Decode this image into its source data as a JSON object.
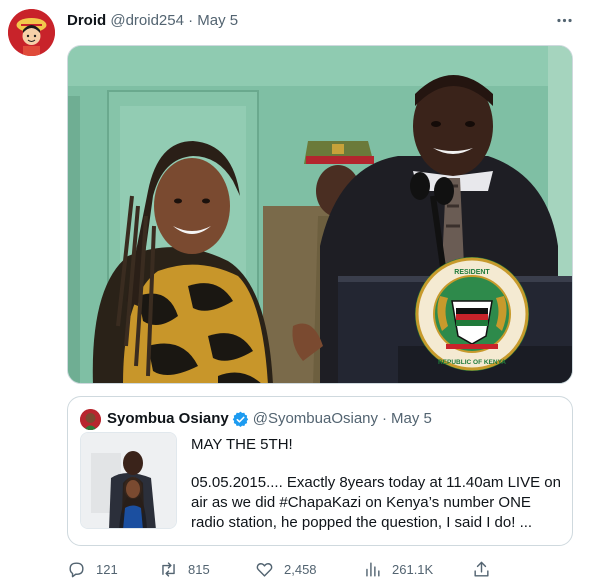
{
  "tweet": {
    "author_name": "Droid",
    "author_handle": "@droid254",
    "date": "May 5",
    "separator": "·"
  },
  "quoted": {
    "author_name": "Syombua Osiany",
    "author_handle": "@SyombuaOsiany",
    "date": "May 5",
    "line1": "MAY THE 5TH!",
    "line2": "05.05.2015.... Exactly 8years today at 11.40am LIVE on air as we did #ChapaKazi on Kenya’s number ONE radio station, he popped the question, I said I do! ..."
  },
  "seal": {
    "text": "RESIDENT REPUBLIC OF KENYA"
  },
  "actions": {
    "replies": "121",
    "retweets": "815",
    "likes": "2,458",
    "views": "261.1K"
  },
  "colors": {
    "text_primary": "#0f1419",
    "text_secondary": "#536471",
    "border": "#cfd9de",
    "verified_blue": "#1d9bf0"
  },
  "icons": [
    "more-icon",
    "verified-badge-icon",
    "reply-icon",
    "retweet-icon",
    "like-icon",
    "views-icon",
    "share-icon"
  ]
}
